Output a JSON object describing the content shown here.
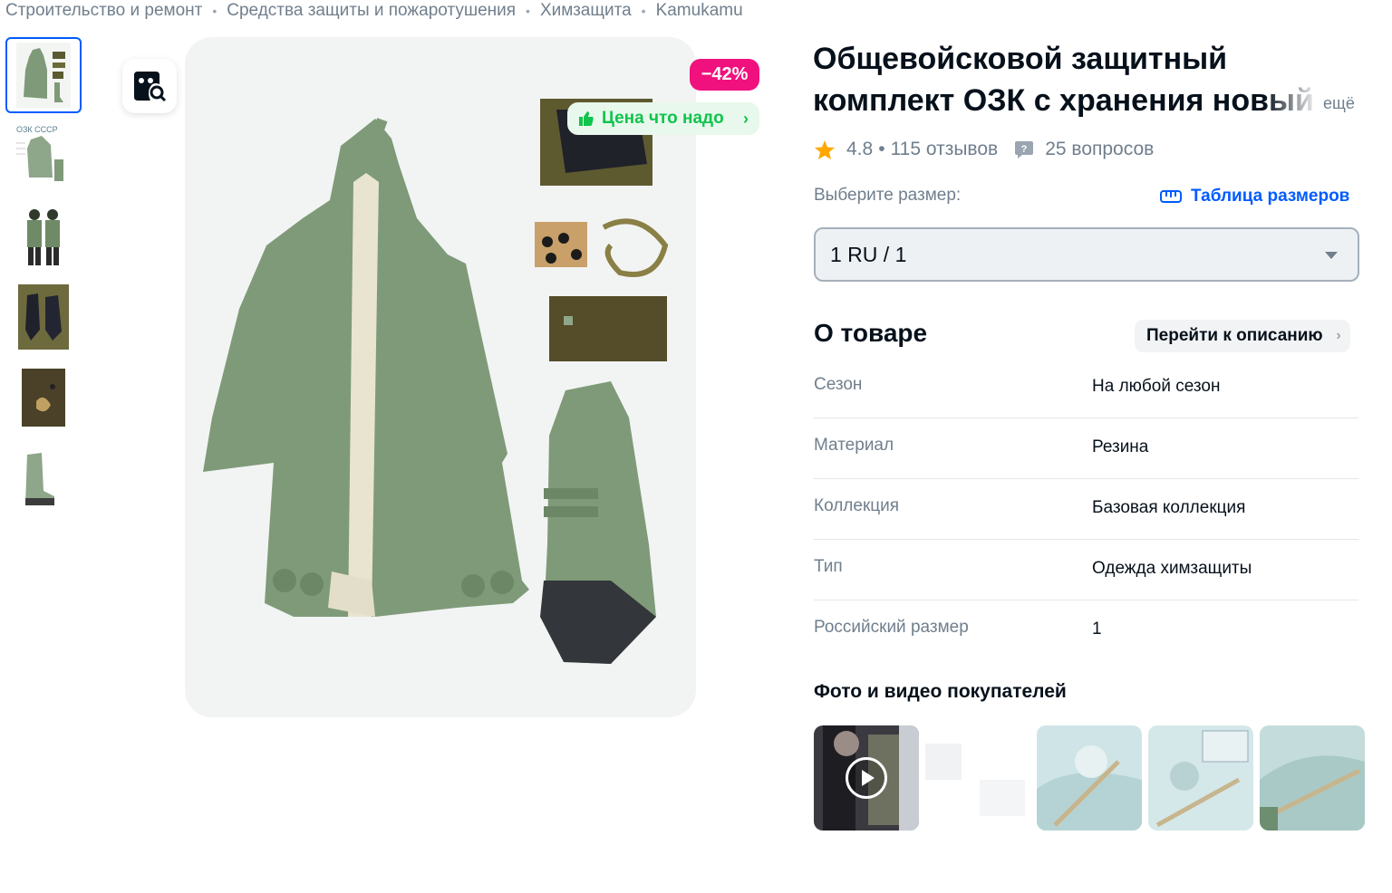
{
  "breadcrumb": [
    "Строительство и ремонт",
    "Средства защиты и пожаротушения",
    "Химзащита",
    "Kamukamu"
  ],
  "thumbnails": [
    {
      "icon": "photo-coat-kit-icon",
      "active": true
    },
    {
      "icon": "photo-ozk-ussr-icon",
      "caption": "ОЗК СССР"
    },
    {
      "icon": "photo-two-people-icon"
    },
    {
      "icon": "photo-gloves-icon"
    },
    {
      "icon": "photo-bag-icon"
    },
    {
      "icon": "photo-boots-icon"
    }
  ],
  "gallery": {
    "discount": "−42%",
    "price_badge": "Цена что надо",
    "visual_search_icon": "visual-search-icon"
  },
  "product": {
    "title_line1": "Общевойсковой защитный",
    "title_line2": "комплект ОЗК с хранения новый",
    "more": "ещё",
    "rating": "4.8",
    "reviews": "115 отзывов",
    "questions": "25 вопросов"
  },
  "size": {
    "label": "Выберите размер:",
    "table_link": "Таблица размеров",
    "selected": "1 RU / 1"
  },
  "about": {
    "title": "О товаре",
    "to_description": "Перейти к описанию",
    "specs": [
      {
        "key": "Сезон",
        "value": "На любой сезон"
      },
      {
        "key": "Материал",
        "value": "Резина"
      },
      {
        "key": "Коллекция",
        "value": "Базовая коллекция"
      },
      {
        "key": "Тип",
        "value": "Одежда химзащиты"
      },
      {
        "key": "Российский размер",
        "value": "1"
      }
    ]
  },
  "ugc": {
    "title": "Фото и видео покупателей",
    "items": [
      "video",
      "photo",
      "photo",
      "photo",
      "photo"
    ]
  },
  "colors": {
    "accent": "#005bff",
    "discount": "#f1117e",
    "good_price": "#10c44c",
    "star": "#ffa800",
    "coat": "#7f9a79"
  }
}
